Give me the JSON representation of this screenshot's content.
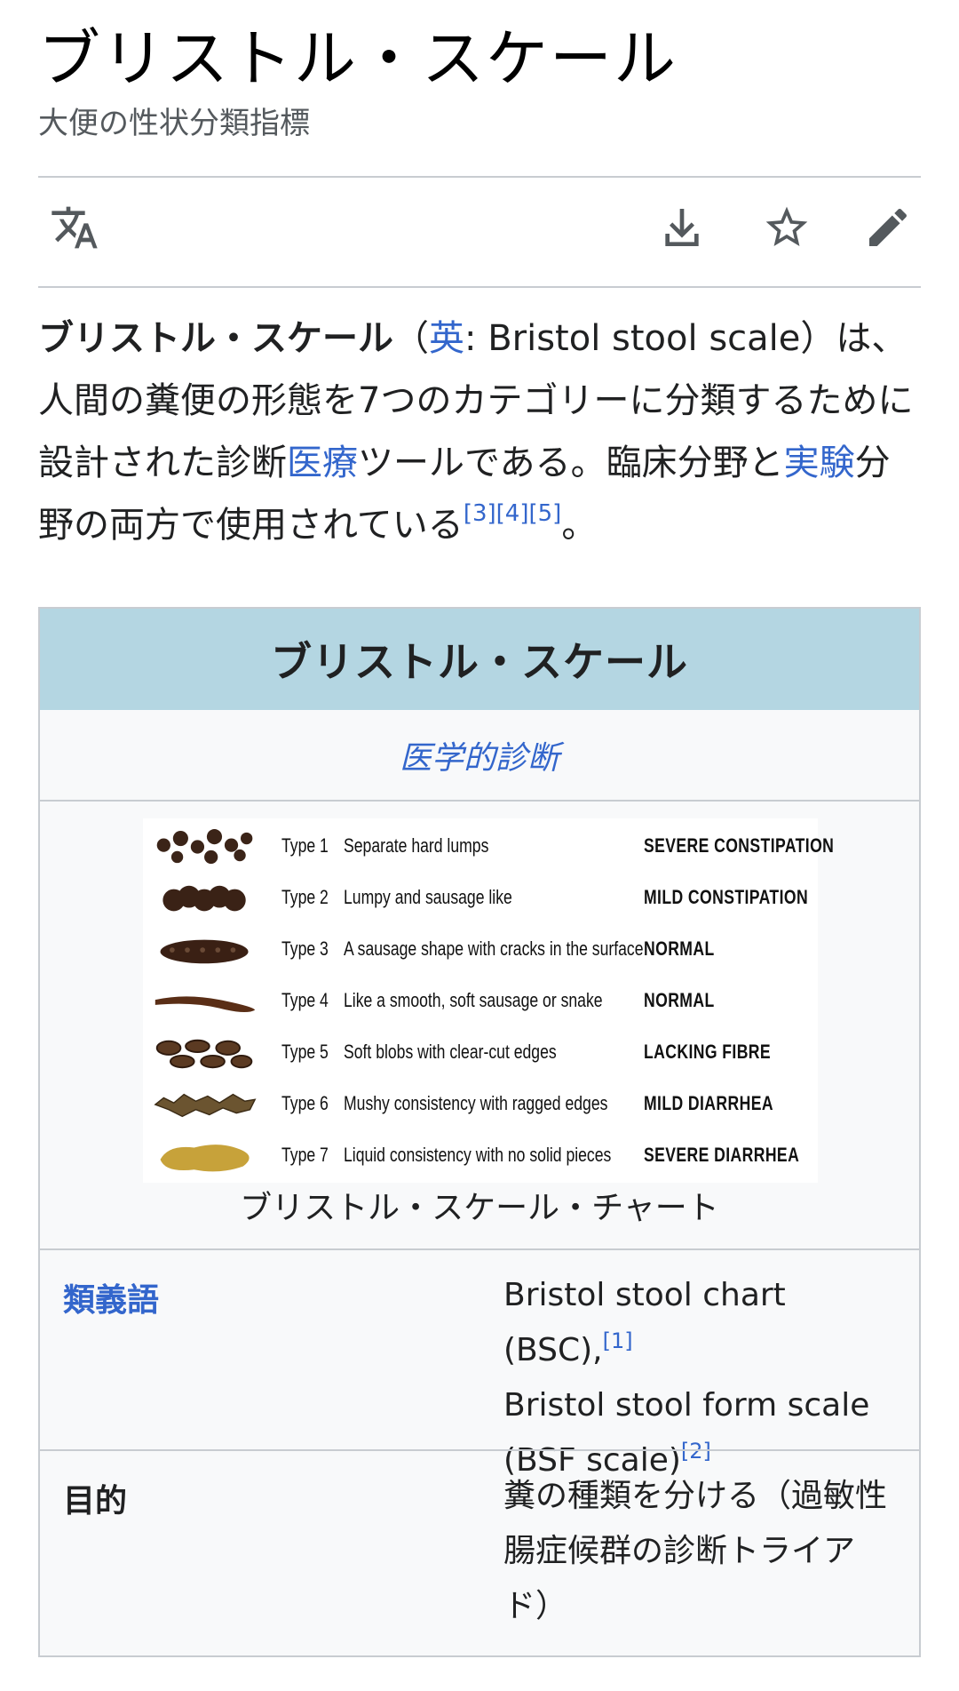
{
  "article": {
    "title": "ブリストル・スケール",
    "subtitle": "大便の性状分類指標"
  },
  "toolbar": {
    "language_icon": "translate-icon",
    "download_icon": "download-icon",
    "watch_icon": "star-icon",
    "edit_icon": "pencil-icon"
  },
  "lead": {
    "bold_title": "ブリストル・スケール",
    "paren_open": "（",
    "lang_link": "英",
    "english_name": ": Bristol stool scale",
    "paren_close": "）は、人間の糞便の形態を7つのカテゴリーに分類するために設計された診断",
    "link_medicine": "医療",
    "text_2": "ツールである。臨床分野と",
    "link_experiment": "実験",
    "text_3": "分野の両方で使用されている",
    "ref_3": "[3]",
    "ref_4": "[4]",
    "ref_5": "[5]",
    "end": "。"
  },
  "infobox": {
    "header": "ブリストル・スケール",
    "category_link": "医学的診断",
    "chart_rows": [
      {
        "type": "Type 1",
        "desc": "Separate hard lumps",
        "cat": "SEVERE CONSTIPATION"
      },
      {
        "type": "Type 2",
        "desc": "Lumpy and sausage like",
        "cat": "MILD CONSTIPATION"
      },
      {
        "type": "Type 3",
        "desc": "A sausage shape with cracks in the surface",
        "cat": "NORMAL"
      },
      {
        "type": "Type 4",
        "desc": "Like a smooth, soft sausage or snake",
        "cat": "NORMAL"
      },
      {
        "type": "Type 5",
        "desc": "Soft blobs with clear-cut edges",
        "cat": "LACKING FIBRE"
      },
      {
        "type": "Type 6",
        "desc": "Mushy consistency with ragged edges",
        "cat": "MILD DIARRHEA"
      },
      {
        "type": "Type 7",
        "desc": "Liquid consistency with no solid pieces",
        "cat": "SEVERE DIARRHEA"
      }
    ],
    "caption": "ブリストル・スケール・チャート",
    "synonyms_label": "類義語",
    "synonyms_line1": "Bristol stool chart (BSC),",
    "synonyms_ref1": "[1]",
    "synonyms_line2": "Bristol stool form scale",
    "synonyms_line3": "(BSF scale)",
    "synonyms_ref2": "[2]",
    "purpose_label": "目的",
    "purpose_value": "糞の種類を分ける（過敏性腸症候群の診断トライアド）"
  },
  "colors": {
    "link": "#3366cc",
    "infobox_header": "#b4d6e2",
    "infobox_bg": "#f8f9fa",
    "border": "#c8ccd1"
  }
}
